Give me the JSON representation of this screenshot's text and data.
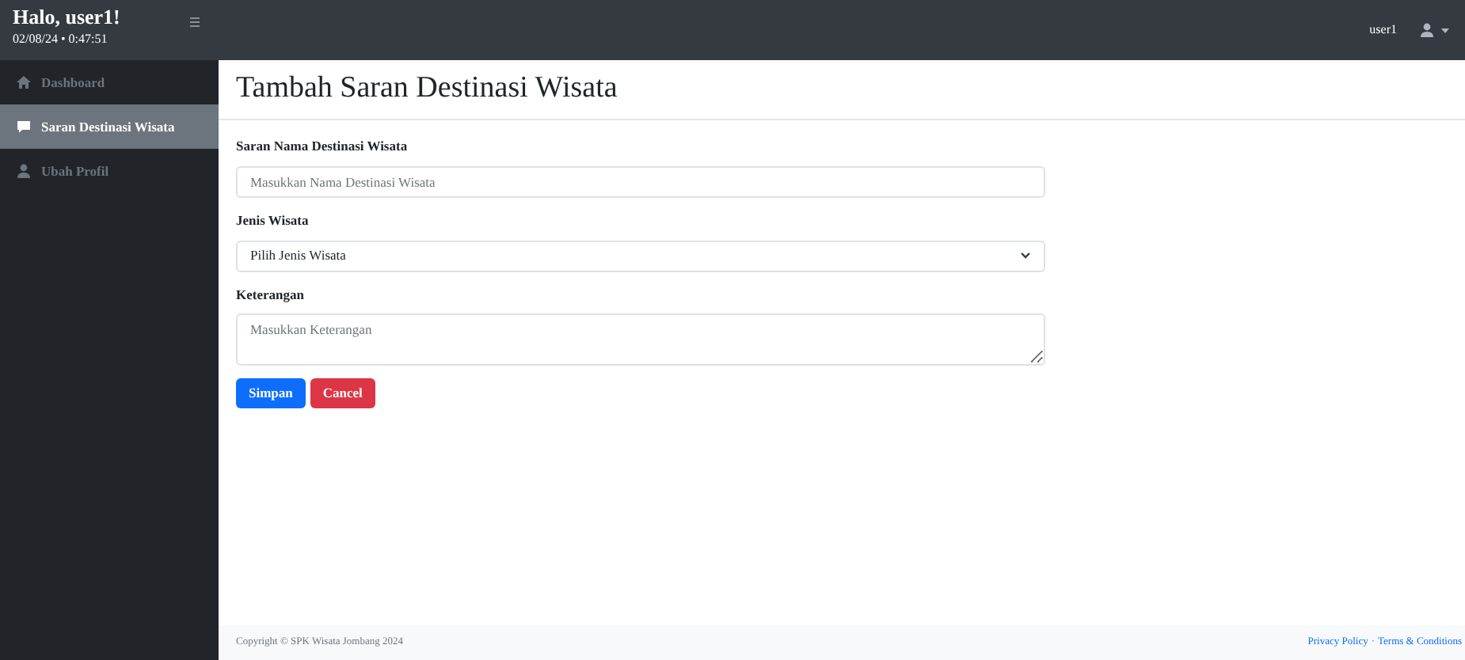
{
  "sidebar": {
    "greeting": "Halo, user1!",
    "datetime": "02/08/24 • 0:47:51",
    "items": [
      {
        "label": "Dashboard",
        "kind": "home",
        "selected": false
      },
      {
        "label": "Saran Destinasi Wisata",
        "kind": "comment",
        "selected": true
      },
      {
        "label": "Ubah Profil",
        "kind": "user",
        "selected": false
      }
    ]
  },
  "topbar": {
    "username": "user1"
  },
  "page_title": "Tambah Saran Destinasi Wisata",
  "form": {
    "fields": [
      {
        "kind": "input",
        "label": "Saran Nama Destinasi Wisata",
        "placeholder": "Masukkan Nama Destinasi Wisata"
      },
      {
        "kind": "select",
        "label": "Jenis Wisata",
        "value": "Pilih Jenis Wisata"
      },
      {
        "kind": "textarea",
        "label": "Keterangan",
        "placeholder": "Masukkan Keterangan"
      }
    ],
    "buttons": [
      {
        "label": "Simpan",
        "kind": "primary"
      },
      {
        "label": "Cancel",
        "kind": "danger"
      }
    ]
  },
  "footer": {
    "copyright": "Copyright © SPK Wisata Jombang 2024",
    "links": [
      "Privacy Policy",
      "Terms & Conditions"
    ],
    "separator": "·"
  }
}
